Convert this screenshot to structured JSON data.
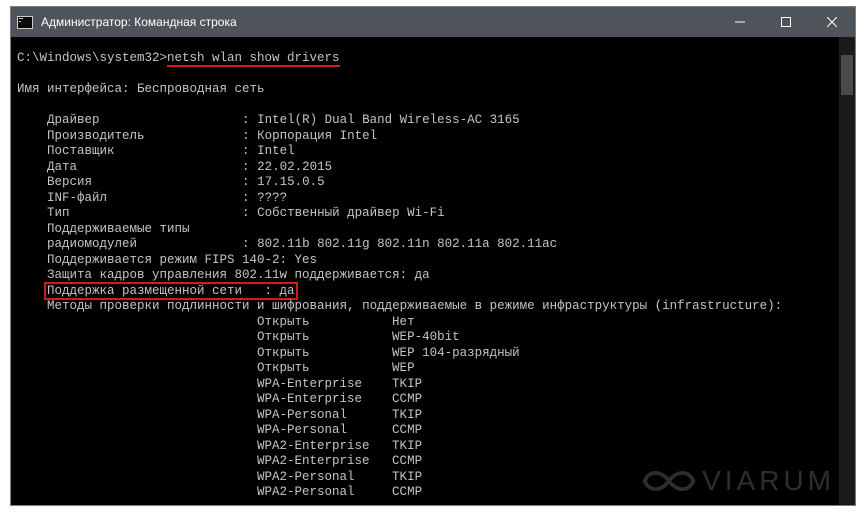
{
  "window": {
    "title": "Администратор: Командная строка"
  },
  "prompt": "C:\\Windows\\system32>",
  "command": "netsh wlan show drivers",
  "interface_line": "Имя интерфейса: Беспроводная сеть",
  "fields": {
    "driver": {
      "label": "Драйвер",
      "value": "Intel(R) Dual Band Wireless-AC 3165"
    },
    "vendor": {
      "label": "Производитель",
      "value": "Корпорация Intel"
    },
    "provider": {
      "label": "Поставщик",
      "value": "Intel"
    },
    "date": {
      "label": "Дата",
      "value": "22.02.2015"
    },
    "version": {
      "label": "Версия",
      "value": "17.15.0.5"
    },
    "inf": {
      "label": "INF-файл",
      "value": "????"
    },
    "type": {
      "label": "Тип",
      "value": "Собственный драйвер Wi-Fi"
    },
    "radios_l1": "Поддерживаемые типы",
    "radios_l2": {
      "label": "радиомодулей",
      "value": "802.11b 802.11g 802.11n 802.11a 802.11ac"
    },
    "fips": "Поддерживается режим FIPS 140-2: Yes",
    "mgmt_frames": "Защита кадров управления 802.11w поддерживается: да",
    "hosted": "Поддержка размещенной сети   : да",
    "auth_header": "Методы проверки подлинности и шифрования, поддерживаемые в режиме инфраструктуры (infrastructure):"
  },
  "auth_table": [
    {
      "a": "Открыть",
      "c": "Нет"
    },
    {
      "a": "Открыть",
      "c": "WEP-40bit"
    },
    {
      "a": "Открыть",
      "c": "WEP 104-разрядный"
    },
    {
      "a": "Открыть",
      "c": "WEP"
    },
    {
      "a": "WPA-Enterprise",
      "c": "TKIP"
    },
    {
      "a": "WPA-Enterprise",
      "c": "CCMP"
    },
    {
      "a": "WPA-Personal",
      "c": "TKIP"
    },
    {
      "a": "WPA-Personal",
      "c": "CCMP"
    },
    {
      "a": "WPA2-Enterprise",
      "c": "TKIP"
    },
    {
      "a": "WPA2-Enterprise",
      "c": "CCMP"
    },
    {
      "a": "WPA2-Personal",
      "c": "TKIP"
    },
    {
      "a": "WPA2-Personal",
      "c": "CCMP"
    }
  ],
  "watermark": "VIARUM"
}
